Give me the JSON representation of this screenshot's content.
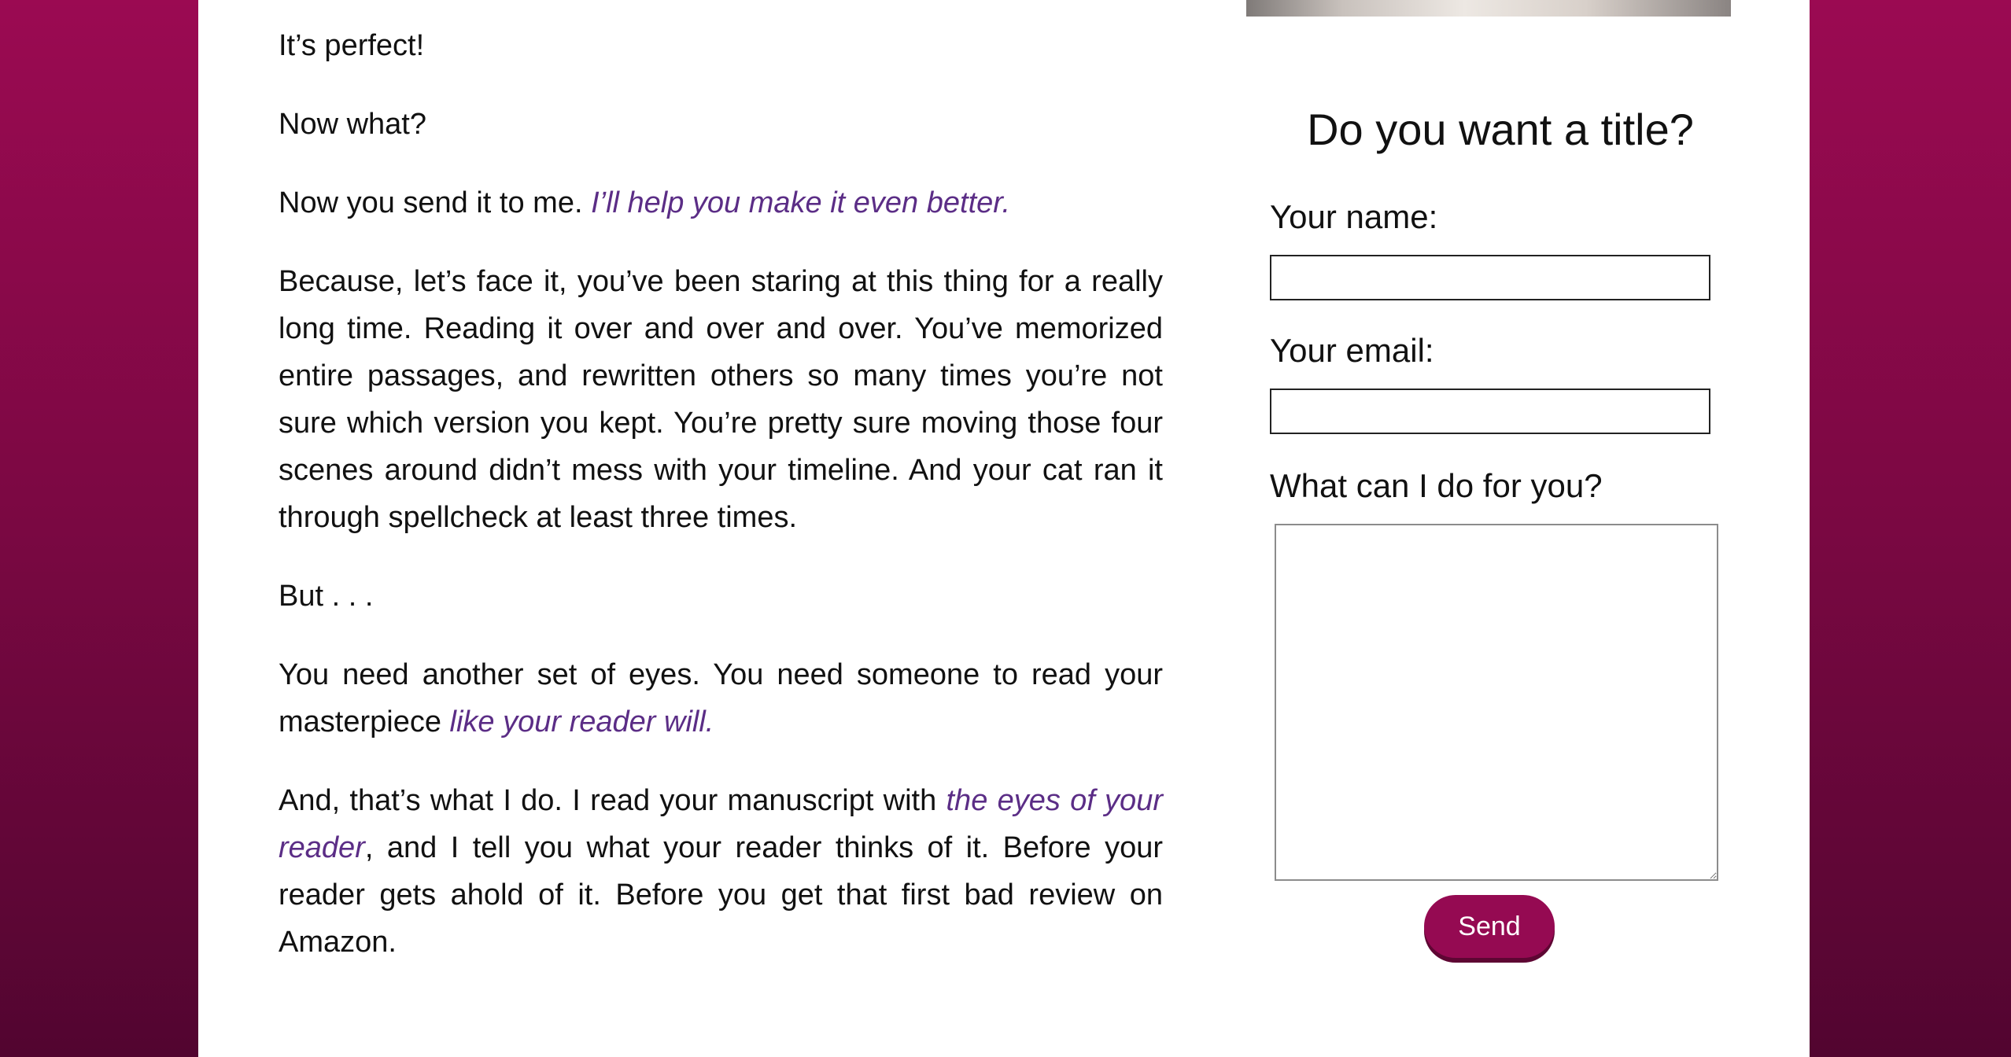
{
  "article": {
    "p1": "It’s perfect!",
    "p2": "Now what?",
    "p3_text": "Now you send it to me. ",
    "p3_em": "I’ll help you make it even better.",
    "p4": "Because, let’s face it, you’ve been staring at this thing for a really long time. Reading it over and over and over. You’ve memorized entire passages, and rewritten others so many times you’re not sure which version you kept. You’re pretty sure moving those four scenes around didn’t mess with your timeline. And your cat ran it through spellcheck at least three times.",
    "p5": "But . . .",
    "p6_text": "You need another set of eyes. You need someone to read your masterpiece ",
    "p6_em": "like your reader will.",
    "p7_text1": "And, that’s what I do. I read your manuscript with ",
    "p7_em": "the eyes of your reader",
    "p7_text2": ", and I tell you what your reader thinks of it. Before your reader gets ahold of it. Before you get that first bad review on Amazon."
  },
  "sidebar": {
    "title": "Do you want a title?",
    "name_label": "Your name:",
    "name_value": "",
    "email_label": "Your email:",
    "email_value": "",
    "message_label": "What can I do for you?",
    "message_value": "",
    "send_label": "Send"
  },
  "colors": {
    "background_top": "#9b0a52",
    "background_bottom": "#520530",
    "accent_text": "#5b2d86",
    "button": "#950a52"
  }
}
